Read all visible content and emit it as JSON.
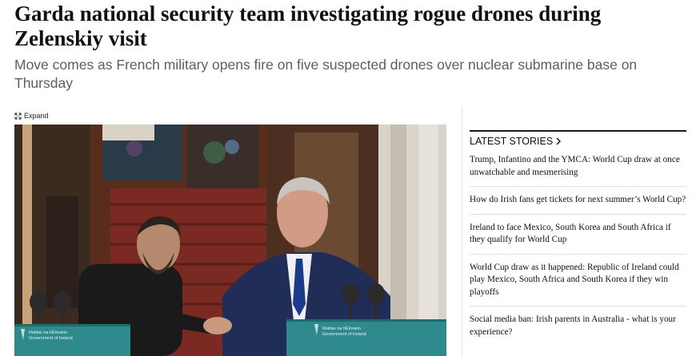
{
  "article": {
    "headline": "Garda national security team investigating rogue drones during Zelenskiy visit",
    "subheadline": "Move comes as French military opens fire on five suspected drones over nuclear submarine base on Thursday"
  },
  "media": {
    "expand_label": "Expand",
    "expand_icon": "expand-arrows-icon",
    "podium_text_line1": "Rialtas na hÉireann",
    "podium_text_line2": "Government of Ireland"
  },
  "latest_stories": {
    "heading": "LATEST STORIES",
    "heading_icon": "chevron-right-icon",
    "items": [
      {
        "title": "Trump, Infantino and the YMCA: World Cup draw at once unwatchable and mesmerising"
      },
      {
        "title": "How do Irish fans get tickets for next summer’s World Cup?"
      },
      {
        "title": "Ireland to face Mexico, South Korea and South Africa if they qualify for World Cup"
      },
      {
        "title": "World Cup draw as it happened: Republic of Ireland could play Mexico, South Africa and South Korea if they win playoffs"
      },
      {
        "title": "Social media ban: Irish parents in Australia - what is your experience?"
      }
    ]
  },
  "colors": {
    "podium_teal": "#2e8a8c",
    "suit_navy": "#1f2d57",
    "carpet_red": "#7a2a22"
  }
}
